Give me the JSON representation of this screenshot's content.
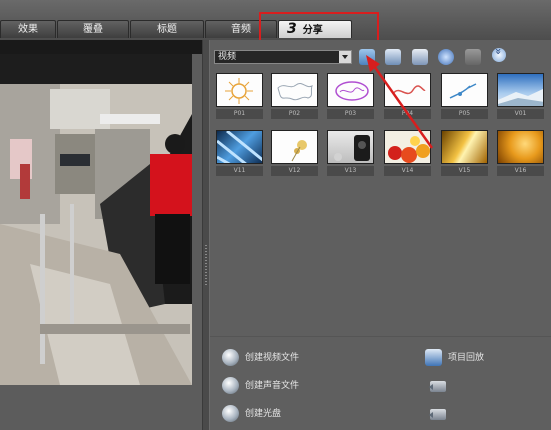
{
  "tabs": [
    {
      "label": "效果"
    },
    {
      "label": "覆叠"
    },
    {
      "label": "标题"
    },
    {
      "label": "音频"
    },
    {
      "number": "3",
      "label": "分享",
      "active": true
    }
  ],
  "library": {
    "category": "视频",
    "toolbar": {
      "icons": [
        "folder-open-icon",
        "import-icon",
        "view-options-icon",
        "refresh-icon",
        "grid-icon",
        "more-icon"
      ]
    },
    "thumbnails": [
      {
        "label": "P01",
        "kind": "sketch-sun"
      },
      {
        "label": "P02",
        "kind": "sketch-map"
      },
      {
        "label": "P03",
        "kind": "sketch-purple"
      },
      {
        "label": "P04",
        "kind": "sketch-red"
      },
      {
        "label": "P05",
        "kind": "sketch-blue"
      },
      {
        "label": "V01",
        "kind": "photo-sky"
      },
      {
        "label": "V11",
        "kind": "photo-blue"
      },
      {
        "label": "V12",
        "kind": "photo-flower"
      },
      {
        "label": "V13",
        "kind": "photo-camera"
      },
      {
        "label": "V14",
        "kind": "photo-fruit"
      },
      {
        "label": "V15",
        "kind": "photo-gold"
      },
      {
        "label": "V16",
        "kind": "photo-orange"
      }
    ]
  },
  "actions": {
    "create_video_file": "创建视频文件",
    "project_playback": "项目回放",
    "create_audio_file": "创建声音文件",
    "create_disc": "创建光盘"
  },
  "colors": {
    "annotation": "#d81e1e",
    "panel": "#5f5f5f",
    "active_tab": "#e6e6e6"
  }
}
